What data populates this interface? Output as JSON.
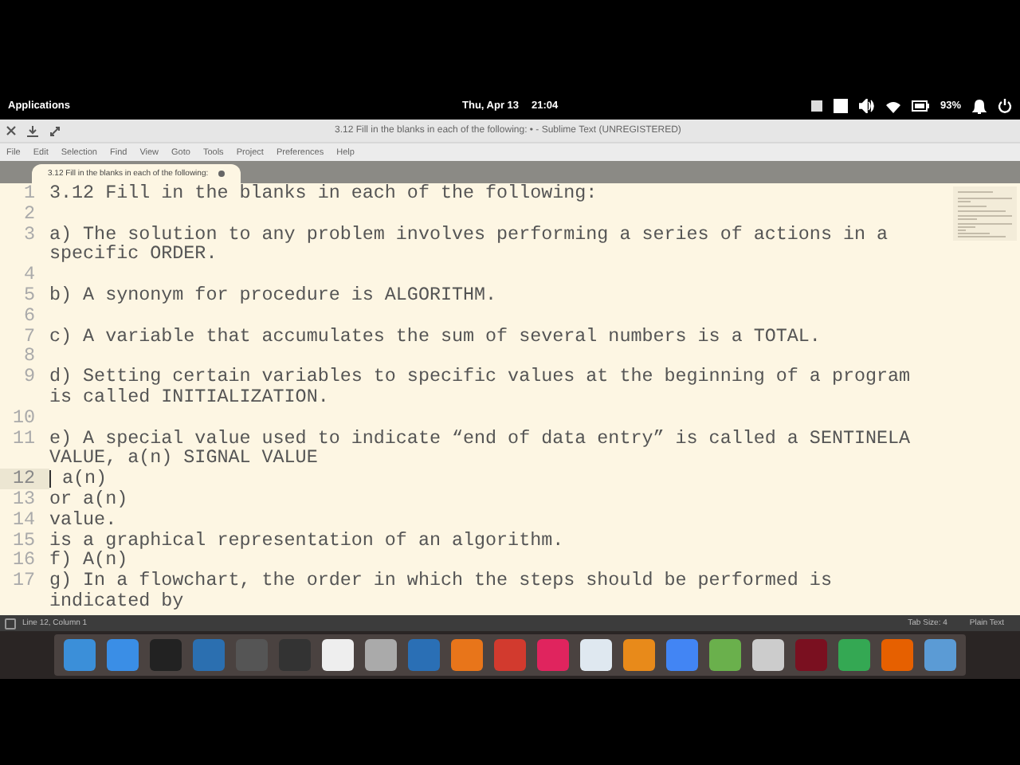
{
  "top_bar": {
    "menu": "Applications",
    "date": "Thu, Apr 13",
    "time": "21:04",
    "battery": "93%"
  },
  "window": {
    "title": "3.12 Fill in the blanks in each of the following: • - Sublime Text (UNREGISTERED)"
  },
  "menu": [
    "File",
    "Edit",
    "Selection",
    "Find",
    "View",
    "Goto",
    "Tools",
    "Project",
    "Preferences",
    "Help"
  ],
  "tabs": [
    {
      "label": "3.12 Fill in the blanks in each of the following:",
      "selected": true,
      "modified": true
    }
  ],
  "lines": [
    {
      "number": "1",
      "rows": [
        "3.12 Fill in the blanks in each of the following:"
      ],
      "current": false
    },
    {
      "number": "2",
      "current": false
    },
    {
      "number": "3",
      "rows": [
        "a) The solution to any problem involves performing a series of actions in a",
        "specific ORDER."
      ],
      "current": false
    },
    {
      "number": "4",
      "current": false
    },
    {
      "number": "5",
      "rows": [
        "b) A synonym for procedure is ALGORITHM."
      ],
      "current": false
    },
    {
      "number": "6",
      "current": false
    },
    {
      "number": "7",
      "rows": [
        "c) A variable that accumulates the sum of several numbers is a TOTAL."
      ],
      "current": false
    },
    {
      "number": "8",
      "current": false
    },
    {
      "number": "9",
      "rows": [
        "d) Setting certain variables to specific values at the beginning of a program",
        "is called INITIALIZATION."
      ],
      "current": false
    },
    {
      "number": "10",
      "current": false
    },
    {
      "number": "11",
      "rows": [
        "e) A special value used to indicate “end of data entry” is called a SENTINELA",
        "VALUE, a(n) SIGNAL VALUE"
      ],
      "current": false
    },
    {
      "number": "12",
      "rows": [
        " a(n)"
      ],
      "current": true
    },
    {
      "number": "13",
      "rows": [
        "or a(n)"
      ],
      "current": false
    },
    {
      "number": "14",
      "rows": [
        "value."
      ],
      "current": false
    },
    {
      "number": "15",
      "rows": [
        "is a graphical representation of an algorithm."
      ],
      "current": false
    },
    {
      "number": "16",
      "rows": [
        "f) A(n)"
      ],
      "current": false
    },
    {
      "number": "17",
      "rows": [
        "g) In a flowchart, the order in which the steps should be performed is",
        "indicated by"
      ],
      "current": false
    }
  ],
  "status_bar": {
    "position": "Line 12, Column 1",
    "tab_size": "Tab Size: 4",
    "syntax": "Plain Text"
  }
}
